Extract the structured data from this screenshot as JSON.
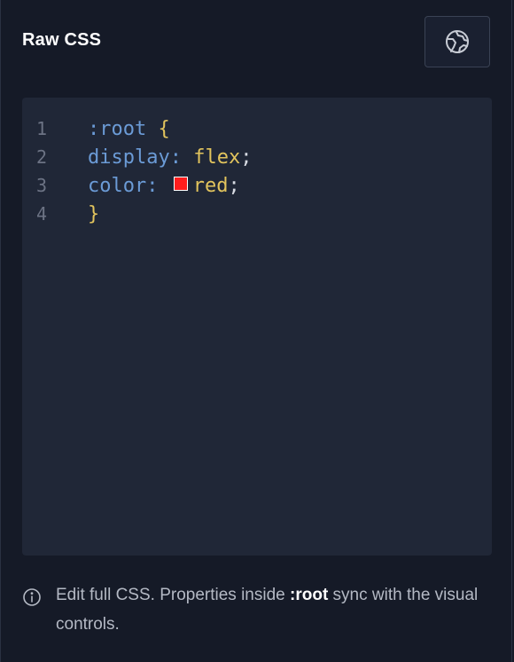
{
  "panel": {
    "title": "Raw CSS",
    "style_button_icon": "palette-icon"
  },
  "editor": {
    "lines": [
      {
        "num": "1",
        "selector": ":root",
        "open_brace": "{"
      },
      {
        "num": "2",
        "property": "display",
        "colon": ":",
        "value": "flex",
        "semicolon": ";"
      },
      {
        "num": "3",
        "property": "color",
        "colon": ":",
        "swatch_color": "#ff1d1d",
        "value": "red",
        "semicolon": ";"
      },
      {
        "num": "4",
        "close_brace": "}"
      }
    ]
  },
  "help": {
    "icon": "info-icon",
    "text_before": "Edit full CSS. Properties inside ",
    "text_bold": ":root",
    "text_after": " sync with the visual controls."
  },
  "colors": {
    "background": "#151a27",
    "editor_bg": "#202737",
    "selector_blue": "#6b9bd6",
    "value_yellow": "#e2c45d"
  }
}
